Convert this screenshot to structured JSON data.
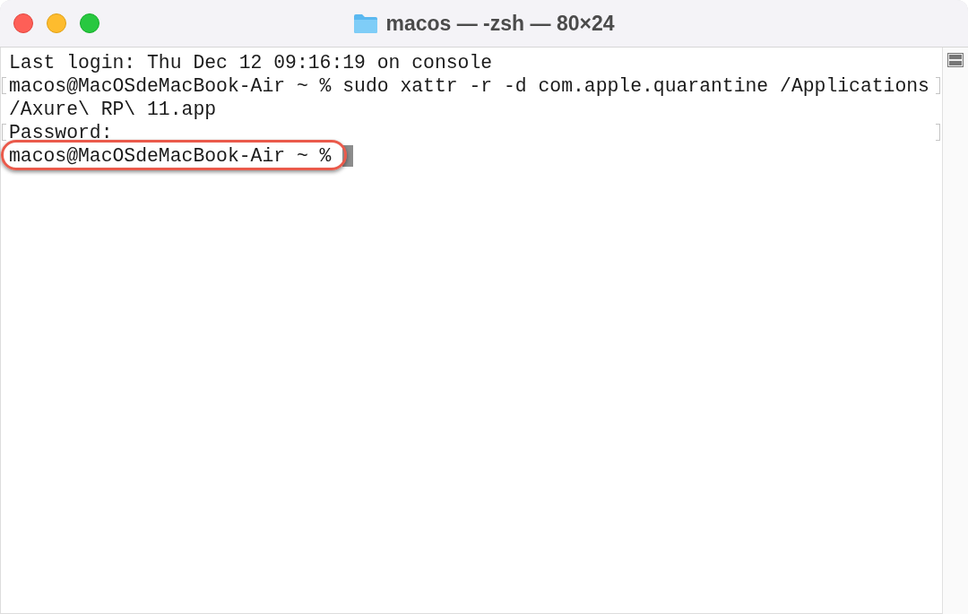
{
  "window": {
    "title": "macos — -zsh — 80×24"
  },
  "terminal": {
    "lines": [
      {
        "text": "Last login: Thu Dec 12 09:16:19 on console",
        "marked": false,
        "highlighted": false
      },
      {
        "text": "macos@MacOSdeMacBook-Air ~ % sudo xattr -r -d com.apple.quarantine /Applications",
        "marked": true,
        "highlighted": false
      },
      {
        "text": "/Axure\\ RP\\ 11.app",
        "marked": false,
        "highlighted": false
      },
      {
        "text": "Password:",
        "marked": true,
        "highlighted": false
      },
      {
        "text": "macos@MacOSdeMacBook-Air ~ %",
        "marked": false,
        "highlighted": true,
        "cursor": true
      }
    ]
  }
}
